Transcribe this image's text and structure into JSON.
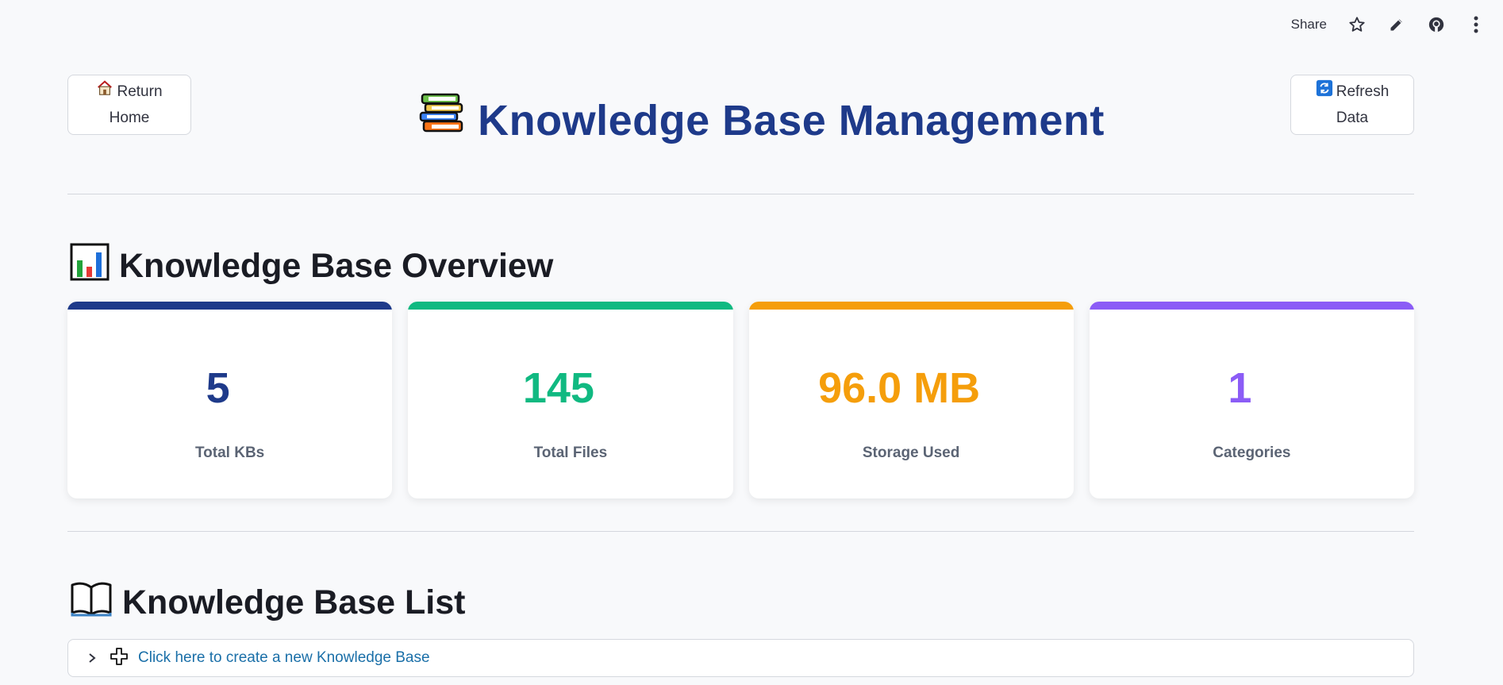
{
  "toolbar": {
    "share_label": "Share",
    "icons": [
      "star-icon",
      "pencil-icon",
      "github-icon",
      "more-vertical-icon"
    ]
  },
  "header": {
    "title": "Knowledge Base Management",
    "return_button": {
      "line1": "Return",
      "line2": "Home",
      "icon": "house-icon"
    },
    "refresh_button": {
      "line1": "Refresh",
      "line2": "Data",
      "icon": "refresh-icon"
    }
  },
  "overview": {
    "heading": "Knowledge Base Overview",
    "icon": "bar-chart-icon",
    "cards": [
      {
        "value": "5",
        "label": "Total KBs",
        "color": "#1e3a8a"
      },
      {
        "value": "145",
        "label": "Total Files",
        "color": "#10b981"
      },
      {
        "value": "96.0 MB",
        "label": "Storage Used",
        "color": "#f59e0b"
      },
      {
        "value": "1",
        "label": "Categories",
        "color": "#8b5cf6"
      }
    ]
  },
  "kb_list": {
    "heading": "Knowledge Base List",
    "icon": "open-book-icon",
    "create_expander": {
      "label": "Click here to create a new Knowledge Base",
      "icon": "plus-icon"
    }
  }
}
